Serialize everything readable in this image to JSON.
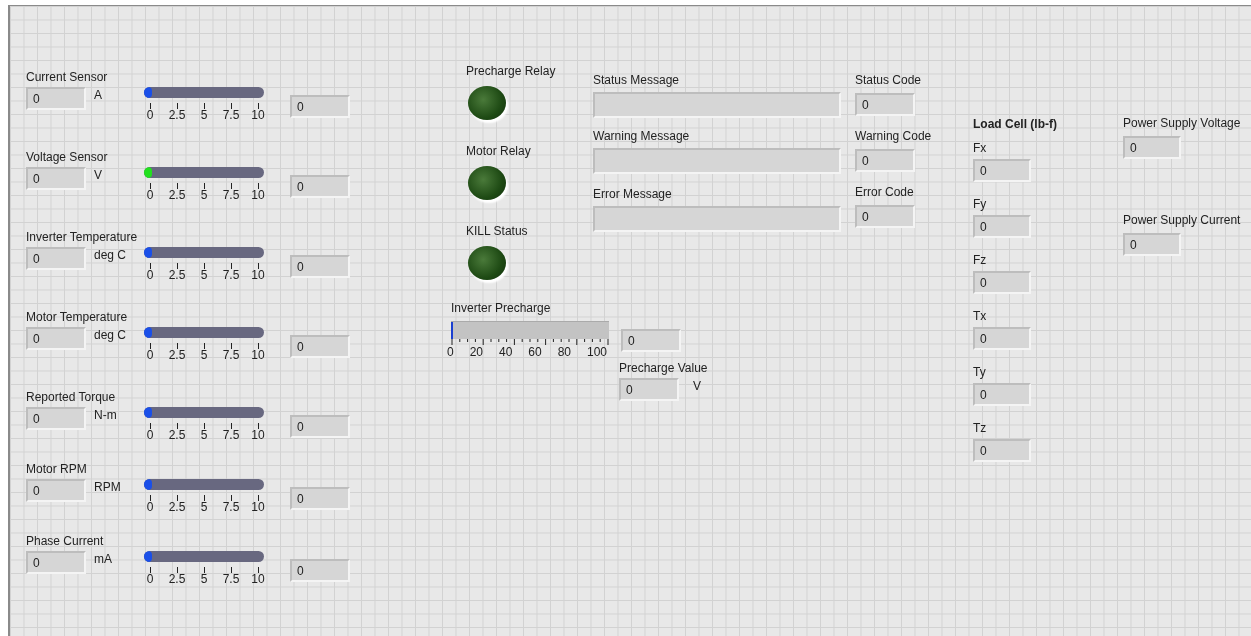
{
  "sensors": [
    {
      "label": "Current Sensor",
      "value": "0",
      "unit": "A",
      "level": 0,
      "color": "#1a4fe8",
      "ticks": [
        "0",
        "2.5",
        "5",
        "7.5",
        "10"
      ],
      "display": "0"
    },
    {
      "label": "Voltage Sensor",
      "value": "0",
      "unit": "V",
      "level": 0,
      "color": "#22e01e",
      "ticks": [
        "0",
        "2.5",
        "5",
        "7.5",
        "10"
      ],
      "display": "0"
    },
    {
      "label": "Inverter Temperature",
      "value": "0",
      "unit": "deg C",
      "level": 0,
      "color": "#1a4fe8",
      "ticks": [
        "0",
        "2.5",
        "5",
        "7.5",
        "10"
      ],
      "display": "0"
    },
    {
      "label": "Motor Temperature",
      "value": "0",
      "unit": "deg C",
      "level": 0,
      "color": "#1a4fe8",
      "ticks": [
        "0",
        "2.5",
        "5",
        "7.5",
        "10"
      ],
      "display": "0"
    },
    {
      "label": "Reported Torque",
      "value": "0",
      "unit": "N-m",
      "level": 0,
      "color": "#1a4fe8",
      "ticks": [
        "0",
        "2.5",
        "5",
        "7.5",
        "10"
      ],
      "display": "0"
    },
    {
      "label": "Motor RPM",
      "value": "0",
      "unit": "RPM",
      "level": 0,
      "color": "#1a4fe8",
      "ticks": [
        "0",
        "2.5",
        "5",
        "7.5",
        "10"
      ],
      "display": "0"
    },
    {
      "label": "Phase Current",
      "value": "0",
      "unit": "mA",
      "level": 0,
      "color": "#1a4fe8",
      "ticks": [
        "0",
        "2.5",
        "5",
        "7.5",
        "10"
      ],
      "display": "0"
    }
  ],
  "leds": [
    {
      "label": "Precharge Relay",
      "on": false
    },
    {
      "label": "Motor Relay",
      "on": false
    },
    {
      "label": "KILL Status",
      "on": false
    }
  ],
  "inverter_precharge": {
    "label": "Inverter Precharge",
    "level": 0,
    "ticks": [
      "0",
      "20",
      "40",
      "60",
      "80",
      "100"
    ],
    "display": "0"
  },
  "precharge_value": {
    "label": "Precharge Value",
    "value": "0",
    "unit": "V"
  },
  "messages": [
    {
      "label": "Status Message"
    },
    {
      "label": "Warning Message"
    },
    {
      "label": "Error Message"
    }
  ],
  "codes": [
    {
      "label": "Status Code",
      "value": "0"
    },
    {
      "label": "Warning Code",
      "value": "0"
    },
    {
      "label": "Error Code",
      "value": "0"
    }
  ],
  "load_cell": {
    "title": "Load Cell (lb-f)",
    "axes": [
      {
        "label": "Fx",
        "value": "0"
      },
      {
        "label": "Fy",
        "value": "0"
      },
      {
        "label": "Fz",
        "value": "0"
      },
      {
        "label": "Tx",
        "value": "0"
      },
      {
        "label": "Ty",
        "value": "0"
      },
      {
        "label": "Tz",
        "value": "0"
      }
    ]
  },
  "power_supply": [
    {
      "label": "Power Supply Voltage",
      "value": "0"
    },
    {
      "label": "Power Supply Current",
      "value": "0"
    }
  ]
}
